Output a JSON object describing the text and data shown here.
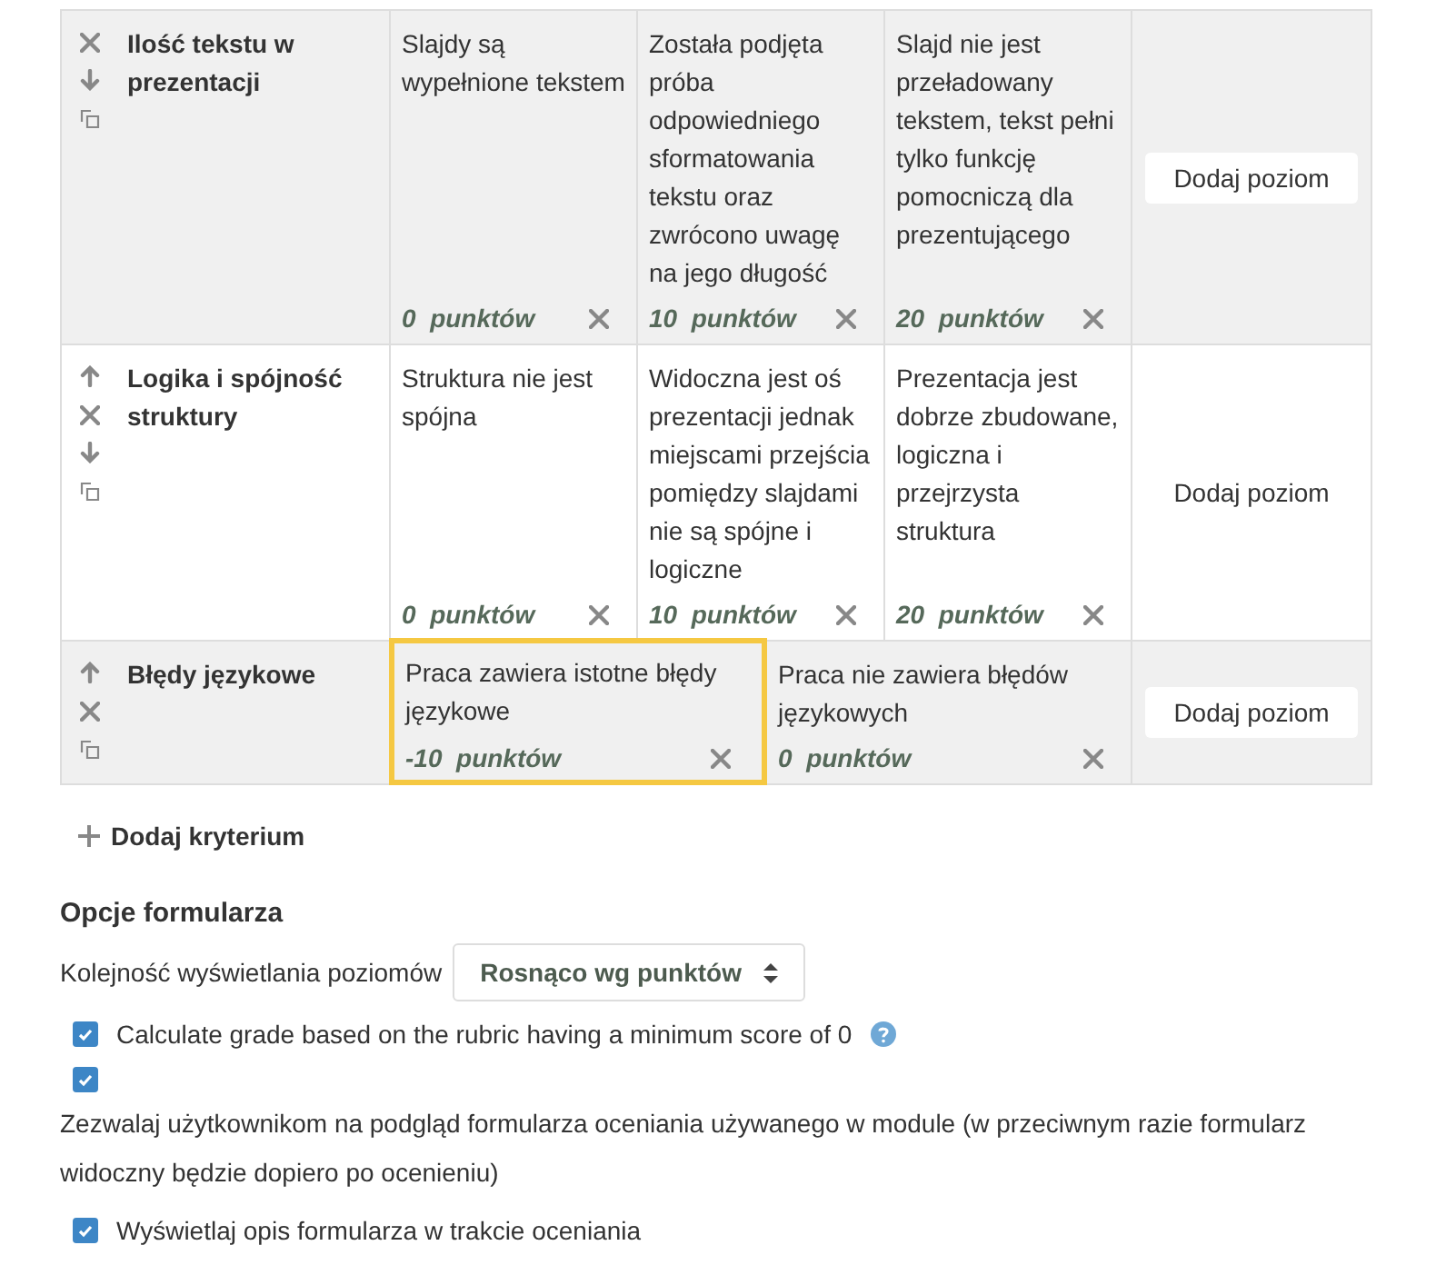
{
  "criteria": [
    {
      "name": "Ilość tekstu w prezentacji",
      "shaded": true,
      "controls": [
        {
          "kind": "delete"
        },
        {
          "kind": "down"
        },
        {
          "kind": "duplicate"
        }
      ],
      "levels": [
        {
          "text": "Slajdy są wypełnione tekstem",
          "points": "0  punktów",
          "highlighted": false
        },
        {
          "text": "Została podjęta próba odpowiedniego sformatowania tekstu oraz zwrócono uwagę na jego długość",
          "points": "10  punktów",
          "highlighted": false
        },
        {
          "text": "Slajd nie jest przeładowany tekstem, tekst pełni tylko funkcję pomocniczą dla prezentującego",
          "points": "20  punktów",
          "highlighted": false
        }
      ],
      "add_level": "Dodaj poziom"
    },
    {
      "name": "Logika i spójność struktury",
      "shaded": false,
      "controls": [
        {
          "kind": "up"
        },
        {
          "kind": "delete"
        },
        {
          "kind": "down"
        },
        {
          "kind": "duplicate"
        }
      ],
      "levels": [
        {
          "text": "Struktura nie jest spójna",
          "points": "0  punktów",
          "highlighted": false
        },
        {
          "text": "Widoczna jest oś prezentacji jednak miejscami przejścia pomiędzy slajdami nie są spójne i logiczne",
          "points": "10  punktów",
          "highlighted": false
        },
        {
          "text": "Prezentacja jest dobrze zbudowane, logiczna i przejrzysta struktura",
          "points": "20  punktów",
          "highlighted": false
        }
      ],
      "add_level": "Dodaj poziom"
    },
    {
      "name": "Błędy językowe",
      "shaded": true,
      "controls": [
        {
          "kind": "up"
        },
        {
          "kind": "delete"
        },
        {
          "kind": "duplicate"
        }
      ],
      "levels": [
        {
          "text": "Praca zawiera istotne błędy językowe",
          "points": "-10  punktów",
          "highlighted": true
        },
        {
          "text": "Praca nie zawiera błędów językowych",
          "points": "0  punktów",
          "highlighted": false
        }
      ],
      "add_level": "Dodaj poziom"
    }
  ],
  "add_criterion": "Dodaj kryterium",
  "options": {
    "heading": "Opcje formularza",
    "order_label": "Kolejność wyświetlania poziomów",
    "order_value": "Rosnąco wg punktów",
    "checkboxes": [
      {
        "label": "Calculate grade based on the rubric having a minimum score of 0",
        "checked": true,
        "help": true,
        "label_below": false
      },
      {
        "label": "Zezwalaj użytkownikom na podgląd formularza oceniania używanego w module (w przeciwnym razie formularz widoczny będzie dopiero po ocenieniu)",
        "checked": true,
        "help": false,
        "label_below": true
      },
      {
        "label": "Wyświetlaj opis formularza w trakcie oceniania",
        "checked": true,
        "help": false,
        "label_below": false
      }
    ]
  }
}
